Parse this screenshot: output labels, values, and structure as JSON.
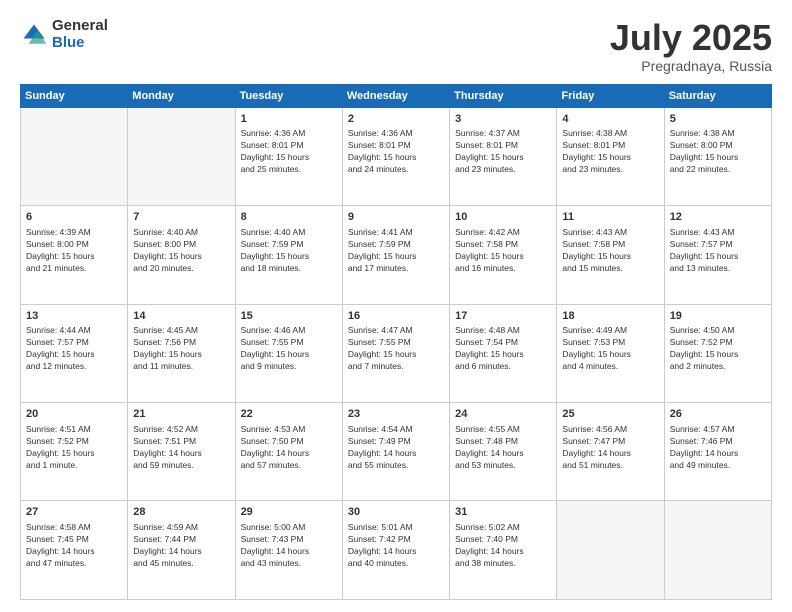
{
  "logo": {
    "general": "General",
    "blue": "Blue"
  },
  "header": {
    "month": "July 2025",
    "location": "Pregradnaya, Russia"
  },
  "days_of_week": [
    "Sunday",
    "Monday",
    "Tuesday",
    "Wednesday",
    "Thursday",
    "Friday",
    "Saturday"
  ],
  "weeks": [
    [
      {
        "day": "",
        "info": ""
      },
      {
        "day": "",
        "info": ""
      },
      {
        "day": "1",
        "info": "Sunrise: 4:36 AM\nSunset: 8:01 PM\nDaylight: 15 hours\nand 25 minutes."
      },
      {
        "day": "2",
        "info": "Sunrise: 4:36 AM\nSunset: 8:01 PM\nDaylight: 15 hours\nand 24 minutes."
      },
      {
        "day": "3",
        "info": "Sunrise: 4:37 AM\nSunset: 8:01 PM\nDaylight: 15 hours\nand 23 minutes."
      },
      {
        "day": "4",
        "info": "Sunrise: 4:38 AM\nSunset: 8:01 PM\nDaylight: 15 hours\nand 23 minutes."
      },
      {
        "day": "5",
        "info": "Sunrise: 4:38 AM\nSunset: 8:00 PM\nDaylight: 15 hours\nand 22 minutes."
      }
    ],
    [
      {
        "day": "6",
        "info": "Sunrise: 4:39 AM\nSunset: 8:00 PM\nDaylight: 15 hours\nand 21 minutes."
      },
      {
        "day": "7",
        "info": "Sunrise: 4:40 AM\nSunset: 8:00 PM\nDaylight: 15 hours\nand 20 minutes."
      },
      {
        "day": "8",
        "info": "Sunrise: 4:40 AM\nSunset: 7:59 PM\nDaylight: 15 hours\nand 18 minutes."
      },
      {
        "day": "9",
        "info": "Sunrise: 4:41 AM\nSunset: 7:59 PM\nDaylight: 15 hours\nand 17 minutes."
      },
      {
        "day": "10",
        "info": "Sunrise: 4:42 AM\nSunset: 7:58 PM\nDaylight: 15 hours\nand 16 minutes."
      },
      {
        "day": "11",
        "info": "Sunrise: 4:43 AM\nSunset: 7:58 PM\nDaylight: 15 hours\nand 15 minutes."
      },
      {
        "day": "12",
        "info": "Sunrise: 4:43 AM\nSunset: 7:57 PM\nDaylight: 15 hours\nand 13 minutes."
      }
    ],
    [
      {
        "day": "13",
        "info": "Sunrise: 4:44 AM\nSunset: 7:57 PM\nDaylight: 15 hours\nand 12 minutes."
      },
      {
        "day": "14",
        "info": "Sunrise: 4:45 AM\nSunset: 7:56 PM\nDaylight: 15 hours\nand 11 minutes."
      },
      {
        "day": "15",
        "info": "Sunrise: 4:46 AM\nSunset: 7:55 PM\nDaylight: 15 hours\nand 9 minutes."
      },
      {
        "day": "16",
        "info": "Sunrise: 4:47 AM\nSunset: 7:55 PM\nDaylight: 15 hours\nand 7 minutes."
      },
      {
        "day": "17",
        "info": "Sunrise: 4:48 AM\nSunset: 7:54 PM\nDaylight: 15 hours\nand 6 minutes."
      },
      {
        "day": "18",
        "info": "Sunrise: 4:49 AM\nSunset: 7:53 PM\nDaylight: 15 hours\nand 4 minutes."
      },
      {
        "day": "19",
        "info": "Sunrise: 4:50 AM\nSunset: 7:52 PM\nDaylight: 15 hours\nand 2 minutes."
      }
    ],
    [
      {
        "day": "20",
        "info": "Sunrise: 4:51 AM\nSunset: 7:52 PM\nDaylight: 15 hours\nand 1 minute."
      },
      {
        "day": "21",
        "info": "Sunrise: 4:52 AM\nSunset: 7:51 PM\nDaylight: 14 hours\nand 59 minutes."
      },
      {
        "day": "22",
        "info": "Sunrise: 4:53 AM\nSunset: 7:50 PM\nDaylight: 14 hours\nand 57 minutes."
      },
      {
        "day": "23",
        "info": "Sunrise: 4:54 AM\nSunset: 7:49 PM\nDaylight: 14 hours\nand 55 minutes."
      },
      {
        "day": "24",
        "info": "Sunrise: 4:55 AM\nSunset: 7:48 PM\nDaylight: 14 hours\nand 53 minutes."
      },
      {
        "day": "25",
        "info": "Sunrise: 4:56 AM\nSunset: 7:47 PM\nDaylight: 14 hours\nand 51 minutes."
      },
      {
        "day": "26",
        "info": "Sunrise: 4:57 AM\nSunset: 7:46 PM\nDaylight: 14 hours\nand 49 minutes."
      }
    ],
    [
      {
        "day": "27",
        "info": "Sunrise: 4:58 AM\nSunset: 7:45 PM\nDaylight: 14 hours\nand 47 minutes."
      },
      {
        "day": "28",
        "info": "Sunrise: 4:59 AM\nSunset: 7:44 PM\nDaylight: 14 hours\nand 45 minutes."
      },
      {
        "day": "29",
        "info": "Sunrise: 5:00 AM\nSunset: 7:43 PM\nDaylight: 14 hours\nand 43 minutes."
      },
      {
        "day": "30",
        "info": "Sunrise: 5:01 AM\nSunset: 7:42 PM\nDaylight: 14 hours\nand 40 minutes."
      },
      {
        "day": "31",
        "info": "Sunrise: 5:02 AM\nSunset: 7:40 PM\nDaylight: 14 hours\nand 38 minutes."
      },
      {
        "day": "",
        "info": ""
      },
      {
        "day": "",
        "info": ""
      }
    ]
  ]
}
